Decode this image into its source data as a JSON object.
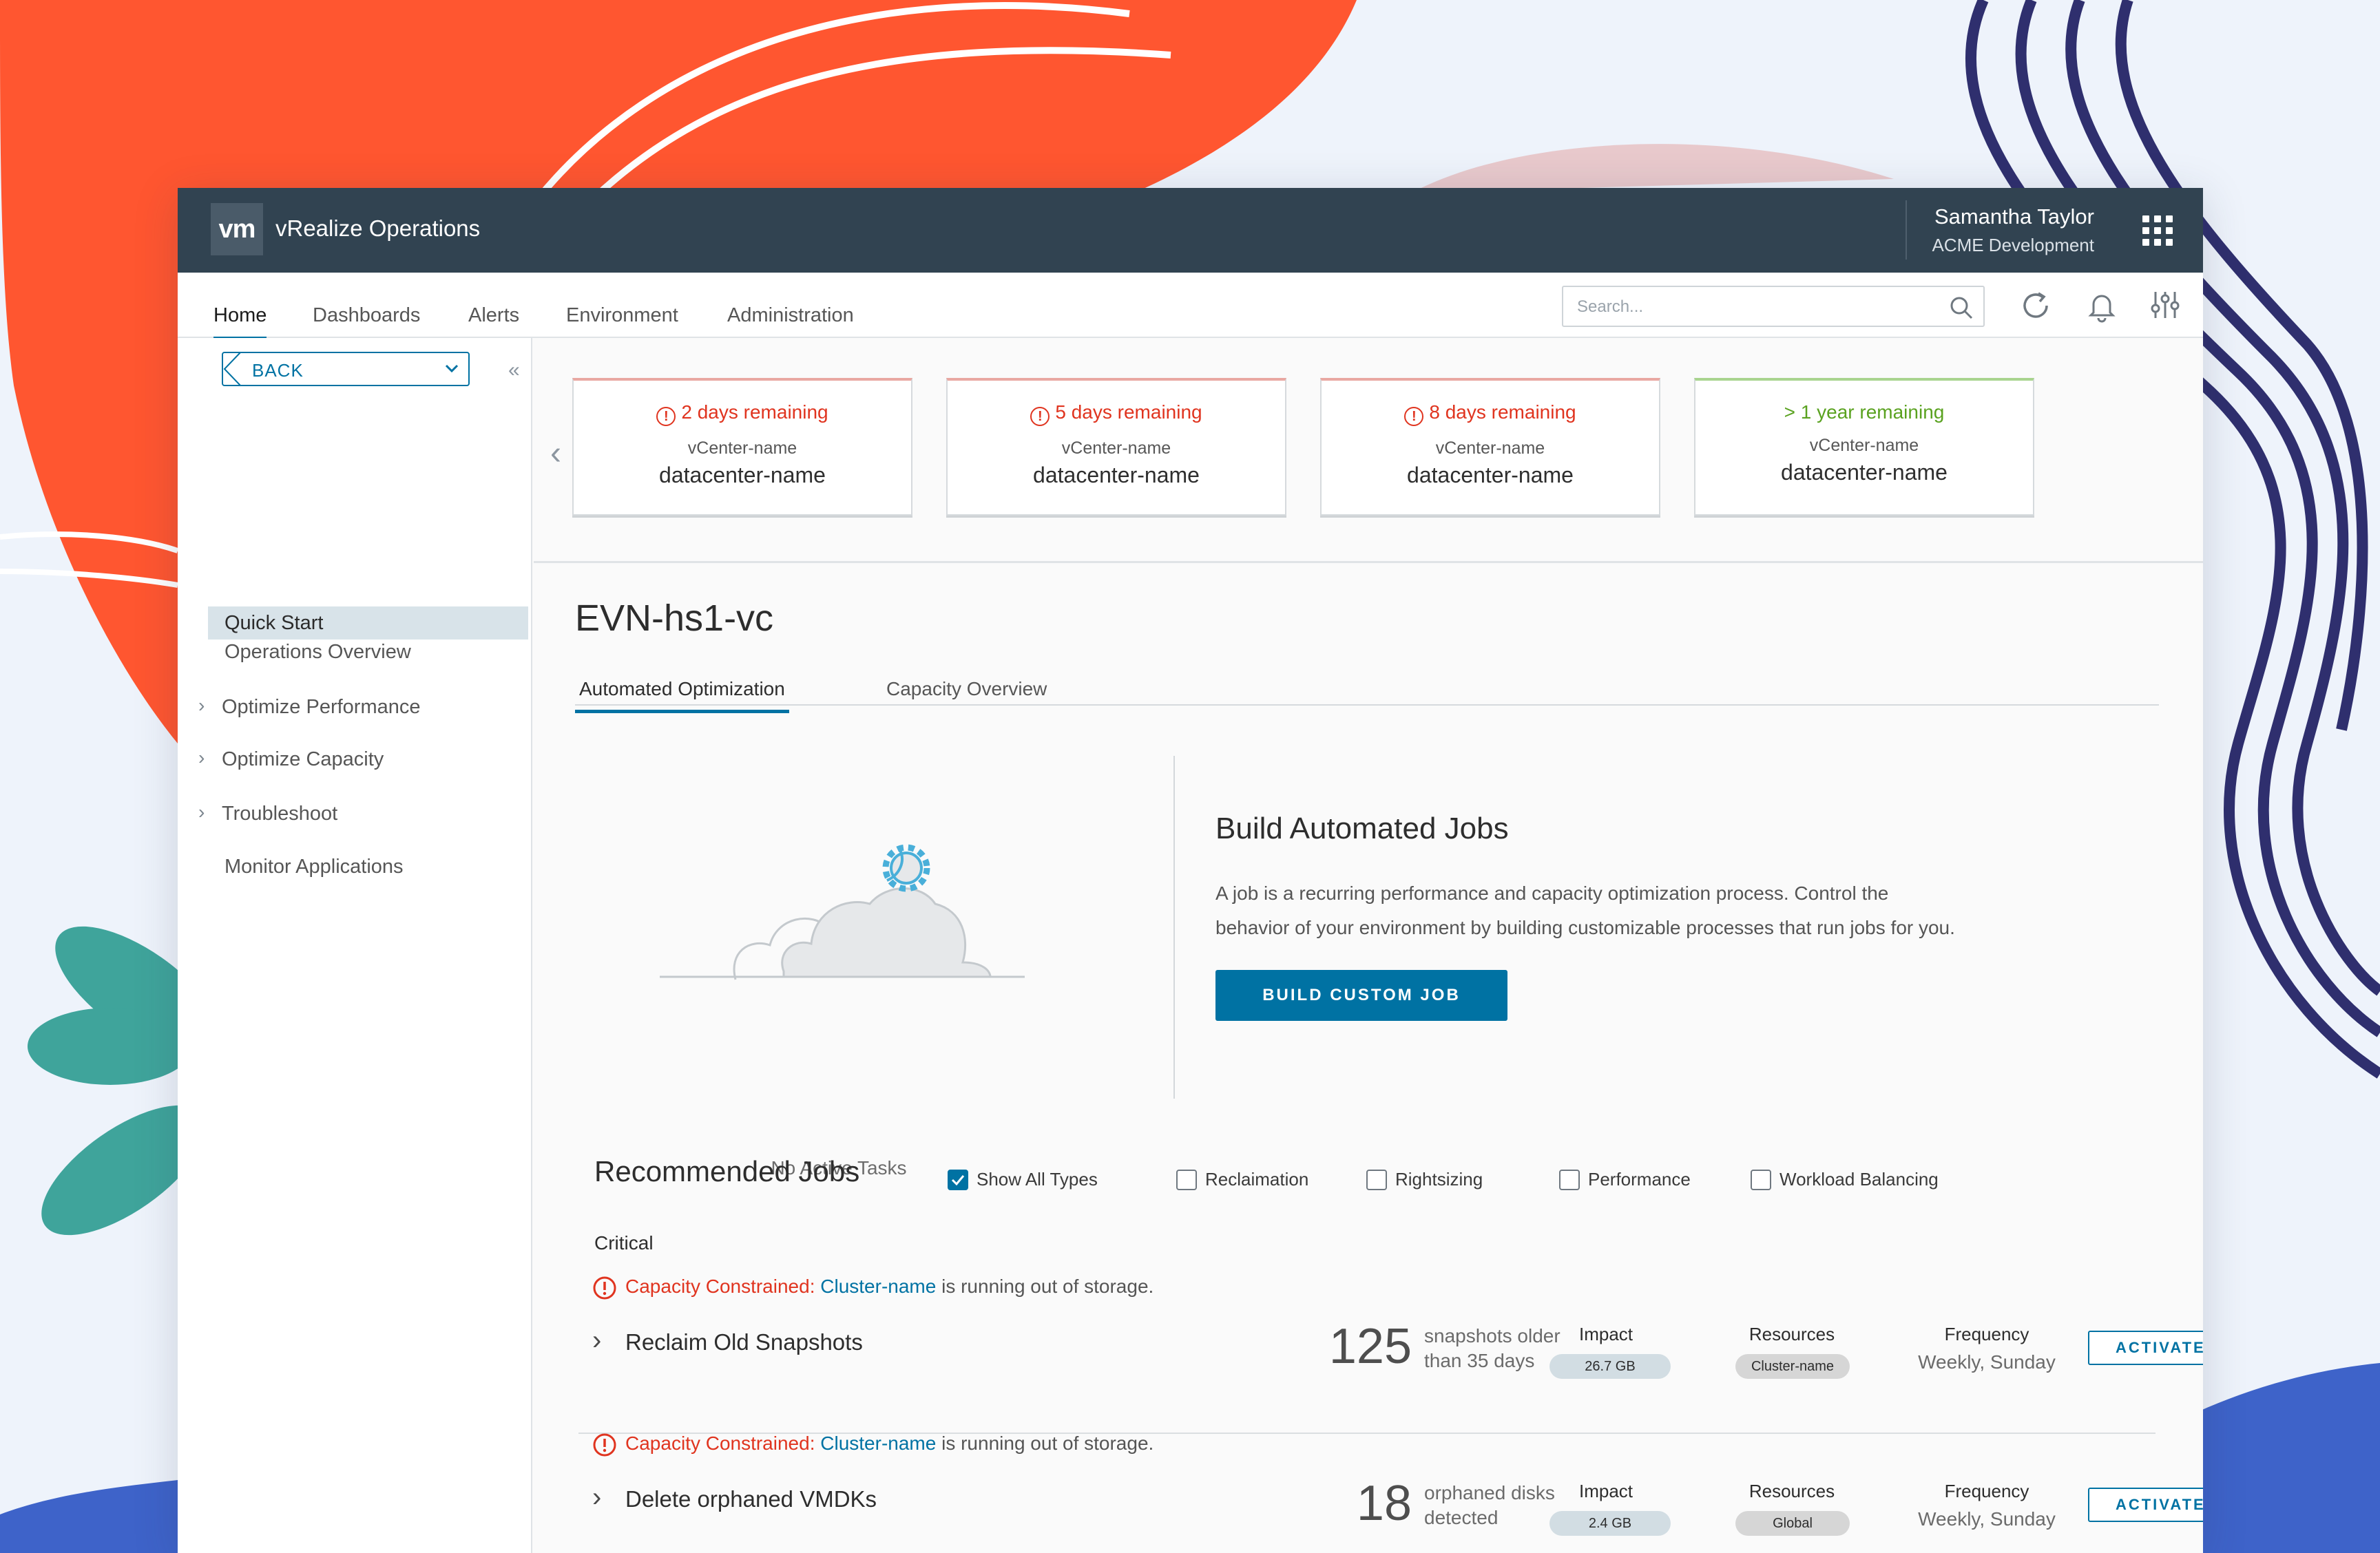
{
  "app": {
    "logo_text": "vm",
    "name": "vRealize Operations",
    "user_name": "Samantha Taylor",
    "user_org": "ACME Development"
  },
  "nav": {
    "tabs": [
      "Home",
      "Dashboards",
      "Alerts",
      "Environment",
      "Administration"
    ],
    "active": "Home",
    "search_placeholder": "Search..."
  },
  "sidebar": {
    "back_label": "BACK",
    "collapse_glyph": "«",
    "items": [
      {
        "label": "Quick Start",
        "selected": true,
        "expandable": false
      },
      {
        "label": "Operations Overview",
        "selected": false,
        "expandable": false
      },
      {
        "label": "Optimize Performance",
        "selected": false,
        "expandable": true
      },
      {
        "label": "Optimize Capacity",
        "selected": false,
        "expandable": true
      },
      {
        "label": "Troubleshoot",
        "selected": false,
        "expandable": true
      },
      {
        "label": "Monitor Applications",
        "selected": false,
        "expandable": false
      }
    ]
  },
  "cards": [
    {
      "status": "2 days remaining",
      "vcenter": "vCenter-name",
      "datacenter": "datacenter-name",
      "level": "critical"
    },
    {
      "status": "5 days remaining",
      "vcenter": "vCenter-name",
      "datacenter": "datacenter-name",
      "level": "critical"
    },
    {
      "status": "8 days remaining",
      "vcenter": "vCenter-name",
      "datacenter": "datacenter-name",
      "level": "critical"
    },
    {
      "status": "> 1 year remaining",
      "vcenter": "vCenter-name",
      "datacenter": "datacenter-name",
      "level": "ok"
    }
  ],
  "main": {
    "title": "EVN-hs1-vc",
    "tabs": [
      "Automated Optimization",
      "Capacity Overview"
    ],
    "active_tab": "Automated Optimization",
    "empty_state": "No Active Tasks",
    "build_title": "Build Automated Jobs",
    "build_desc_line1": "A job is a recurring performance and capacity optimization process. Control the",
    "build_desc_line2": "behavior of your environment by building customizable processes that run jobs for you.",
    "build_button": "BUILD CUSTOM JOB"
  },
  "recommended": {
    "title": "Recommended Jobs",
    "filters": [
      {
        "label": "Show All Types",
        "checked": true
      },
      {
        "label": "Reclaimation",
        "checked": false
      },
      {
        "label": "Rightsizing",
        "checked": false
      },
      {
        "label": "Performance",
        "checked": false
      },
      {
        "label": "Workload Balancing",
        "checked": false
      }
    ],
    "group_label": "Critical",
    "impact_label": "Impact",
    "resources_label": "Resources",
    "frequency_label": "Frequency",
    "activate_label": "ACTIVATE JOB",
    "jobs": [
      {
        "alert_type": "Capacity Constrained:",
        "cluster": "Cluster-name",
        "alert_rest": "is running out of storage.",
        "name": "Reclaim Old Snapshots",
        "count": "125",
        "count_desc_1": "snapshots older",
        "count_desc_2": "than 35 days",
        "impact": "26.7 GB",
        "resources": "Cluster-name",
        "frequency": "Weekly, Sunday"
      },
      {
        "alert_type": "Capacity Constrained:",
        "cluster": "Cluster-name",
        "alert_rest": "is running out of storage.",
        "name": "Delete orphaned VMDKs",
        "count": "18",
        "count_desc_1": "orphaned disks",
        "count_desc_2": "detected",
        "impact": "2.4 GB",
        "resources": "Global",
        "frequency": "Weekly, Sunday"
      }
    ]
  },
  "colors": {
    "header": "#314351",
    "accent": "#0072a3",
    "critical": "#e0341f",
    "ok": "#5aa220"
  }
}
